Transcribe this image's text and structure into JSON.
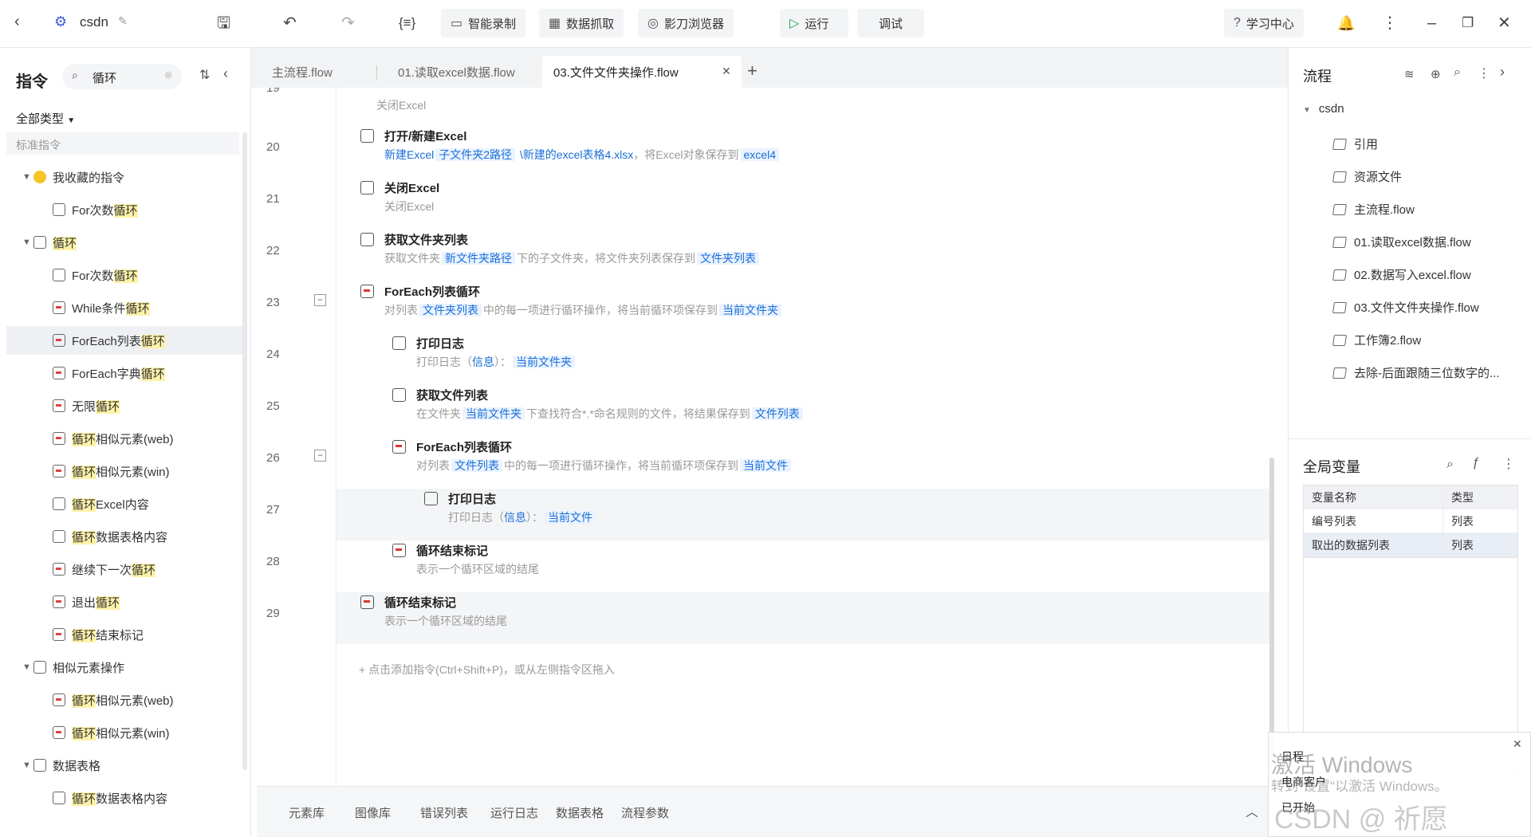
{
  "app": {
    "project": "csdn"
  },
  "toolbar": {
    "smart_record": "智能录制",
    "data_capture": "数据抓取",
    "browser": "影刀浏览器",
    "run": "运行",
    "debug": "调试",
    "learning": "学习中心"
  },
  "left": {
    "title": "指令",
    "search_value": "循环",
    "filter": "全部类型",
    "section": "标准指令",
    "tree": [
      {
        "text": "我收藏的指令",
        "level": 0,
        "icon": "heart-icon"
      },
      {
        "pre": "For次数",
        "hl": "循环",
        "post": "",
        "level": 1,
        "icon": "loop-icon"
      },
      {
        "pre": "",
        "hl": "循环",
        "post": "",
        "level": 0,
        "icon": "refresh-icon"
      },
      {
        "pre": "For次数",
        "hl": "循环",
        "post": "",
        "level": 1,
        "icon": "loop-icon"
      },
      {
        "pre": "While条件",
        "hl": "循环",
        "post": "",
        "level": 1,
        "icon": "list-loop-icon"
      },
      {
        "pre": "ForEach列表",
        "hl": "循环",
        "post": "",
        "level": 1,
        "icon": "list-loop-icon",
        "selected": true
      },
      {
        "pre": "ForEach字典",
        "hl": "循环",
        "post": "",
        "level": 1,
        "icon": "list-loop-icon"
      },
      {
        "pre": "无限",
        "hl": "循环",
        "post": "",
        "level": 1,
        "icon": "list-loop-icon"
      },
      {
        "pre": "",
        "hl": "循环",
        "post": "相似元素(web)",
        "level": 1,
        "icon": "list-loop-icon"
      },
      {
        "pre": "",
        "hl": "循环",
        "post": "相似元素(win)",
        "level": 1,
        "icon": "list-loop-icon"
      },
      {
        "pre": "",
        "hl": "循环",
        "post": "Excel内容",
        "level": 1,
        "icon": "excel-icon"
      },
      {
        "pre": "",
        "hl": "循环",
        "post": "数据表格内容",
        "level": 1,
        "icon": "table-icon"
      },
      {
        "pre": "继续下一次",
        "hl": "循环",
        "post": "",
        "level": 1,
        "icon": "list-loop-icon"
      },
      {
        "pre": "退出",
        "hl": "循环",
        "post": "",
        "level": 1,
        "icon": "list-loop-icon"
      },
      {
        "pre": "",
        "hl": "循环",
        "post": "结束标记",
        "level": 1,
        "icon": "list-loop-icon"
      },
      {
        "text": "相似元素操作",
        "level": 0,
        "icon": "copy-icon"
      },
      {
        "pre": "",
        "hl": "循环",
        "post": "相似元素(web)",
        "level": 1,
        "icon": "list-loop-icon"
      },
      {
        "pre": "",
        "hl": "循环",
        "post": "相似元素(win)",
        "level": 1,
        "icon": "list-loop-icon"
      },
      {
        "text": "数据表格",
        "level": 0,
        "icon": "doc-icon"
      },
      {
        "pre": "",
        "hl": "循环",
        "post": "数据表格内容",
        "level": 1,
        "icon": "table-icon"
      }
    ]
  },
  "tabs": [
    "主流程.flow",
    "01.读取excel数据.flow",
    "03.文件文件夹操作.flow"
  ],
  "editor": {
    "line19": "19",
    "line19_desc": "关闭Excel",
    "rows": [
      {
        "line": "20",
        "title": "打开/新建Excel",
        "parts": [
          [
            "lnk",
            "新建Excel"
          ],
          [
            "chip",
            "子文件夹2路径"
          ],
          [
            "lnk",
            " \\新建的excel表格4.xlsx"
          ],
          [
            "t",
            "，将Excel对象保存到"
          ],
          [
            "chip",
            "excel4"
          ]
        ]
      },
      {
        "line": "21",
        "title": "关闭Excel",
        "parts": [
          [
            "t",
            "关闭Excel"
          ]
        ]
      },
      {
        "line": "22",
        "title": "获取文件夹列表",
        "parts": [
          [
            "t",
            "获取文件夹"
          ],
          [
            "chip",
            "新文件夹路径"
          ],
          [
            "t",
            "下的子文件夹，将文件夹列表保存到"
          ],
          [
            "chip",
            "文件夹列表"
          ]
        ]
      },
      {
        "line": "23",
        "title": "ForEach列表循环",
        "parts": [
          [
            "t",
            "对列表"
          ],
          [
            "chip",
            "文件夹列表"
          ],
          [
            "t",
            "中的每一项进行循环操作，将当前循环项保存到"
          ],
          [
            "chip",
            "当前文件夹"
          ]
        ]
      },
      {
        "line": "24",
        "title": "打印日志",
        "parts": [
          [
            "t",
            "打印日志（"
          ],
          [
            "lnk",
            "信息"
          ],
          [
            "t",
            "）："
          ],
          [
            "chip",
            "当前文件夹"
          ]
        ]
      },
      {
        "line": "25",
        "title": "获取文件列表",
        "parts": [
          [
            "t",
            "在文件夹"
          ],
          [
            "chip",
            "当前文件夹"
          ],
          [
            "t",
            "下查找符合*.*命名规则的文件，将结果保存到"
          ],
          [
            "chip",
            "文件列表"
          ]
        ]
      },
      {
        "line": "26",
        "title": "ForEach列表循环",
        "parts": [
          [
            "t",
            "对列表"
          ],
          [
            "chip",
            "文件列表"
          ],
          [
            "t",
            "中的每一项进行循环操作，将当前循环项保存到"
          ],
          [
            "chip",
            "当前文件"
          ]
        ]
      },
      {
        "line": "27",
        "title": "打印日志",
        "parts": [
          [
            "t",
            "打印日志（"
          ],
          [
            "lnk",
            "信息"
          ],
          [
            "t",
            "）："
          ],
          [
            "chip",
            "当前文件"
          ]
        ]
      },
      {
        "line": "28",
        "title": "循环结束标记",
        "parts": [
          [
            "t",
            "表示一个循环区域的结尾"
          ]
        ]
      },
      {
        "line": "29",
        "title": "循环结束标记",
        "parts": [
          [
            "t",
            "表示一个循环区域的结尾"
          ]
        ]
      }
    ],
    "add_hint": "点击添加指令(Ctrl+Shift+P)，或从左侧指令区拖入"
  },
  "bottom_tabs": [
    "元素库",
    "图像库",
    "错误列表",
    "运行日志",
    "数据表格",
    "流程参数"
  ],
  "right": {
    "title": "流程",
    "root": "csdn",
    "items": [
      "引用",
      "资源文件",
      "主流程.flow",
      "01.读取excel数据.flow",
      "02.数据写入excel.flow",
      "03.文件文件夹操作.flow",
      "工作簿2.flow",
      "去除-后面跟随三位数字的..."
    ],
    "vars_title": "全局变量",
    "var_head": [
      "变量名称",
      "类型"
    ],
    "vars": [
      [
        "编号列表",
        "列表"
      ],
      [
        "取出的数据列表",
        "列表"
      ]
    ]
  },
  "overlay": {
    "activate": "激活 Windows",
    "activate_sub": "转到\"设置\"以激活 Windows。",
    "watermark": "CSDN @ 祈愿",
    "notif_lines": [
      "日程",
      "电商客户",
      "已开始"
    ]
  }
}
